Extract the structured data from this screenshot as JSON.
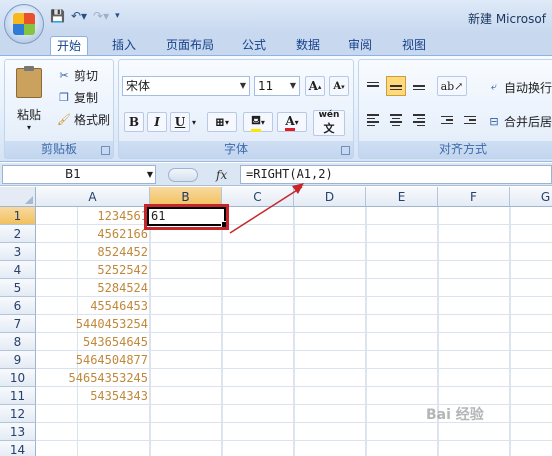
{
  "window": {
    "title": "新建 Microsof"
  },
  "tabs": [
    "开始",
    "插入",
    "页面布局",
    "公式",
    "数据",
    "审阅",
    "视图"
  ],
  "ribbon": {
    "clipboard": {
      "paste": "粘贴",
      "cut": "剪切",
      "copy": "复制",
      "format_painter": "格式刷",
      "label": "剪贴板"
    },
    "font": {
      "name": "宋体",
      "size": "11",
      "label": "字体",
      "bold": "B",
      "italic": "I",
      "underline": "U",
      "grow": "A",
      "shrink": "A",
      "phonetic": "wén"
    },
    "alignment": {
      "wrap_text": "自动换行",
      "merge_center": "合并后居",
      "label": "对齐方式"
    }
  },
  "formula_bar": {
    "name_box": "B1",
    "fx": "fx",
    "formula": "=RIGHT(A1,2)"
  },
  "columns": [
    "A",
    "B",
    "C",
    "D",
    "E",
    "F",
    "G"
  ],
  "rows": [
    "1",
    "2",
    "3",
    "4",
    "5",
    "6",
    "7",
    "8",
    "9",
    "10",
    "11",
    "12",
    "13",
    "14"
  ],
  "column_a": [
    "1234561",
    "4562166",
    "8524452",
    "5252542",
    "5284524",
    "45546453",
    "5440453254",
    "543654645",
    "5464504877",
    "54654353245",
    "54354343"
  ],
  "active_cell": {
    "ref": "B1",
    "value": "61"
  },
  "watermark": "Bai 经验"
}
